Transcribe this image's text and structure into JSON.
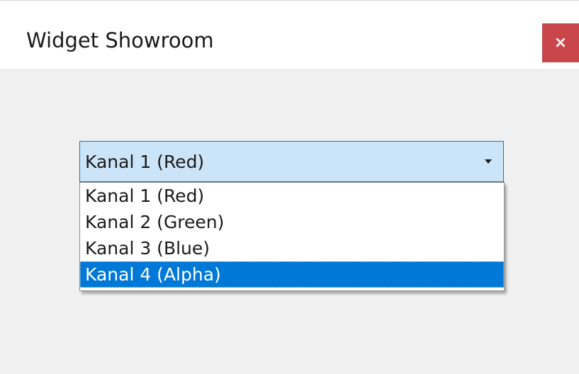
{
  "window": {
    "title": "Widget Showroom",
    "close_label": "×"
  },
  "combo": {
    "selected_value": "Kanal 1 (Red)"
  },
  "dropdown": {
    "options": [
      "Kanal 1 (Red)",
      "Kanal 2 (Green)",
      "Kanal 3 (Blue)",
      "Kanal 4 (Alpha)"
    ],
    "highlighted_option": "Kanal 4 (Alpha)"
  },
  "colors": {
    "titlebar_bg": "#ffffff",
    "window_bg": "#f0f0f0",
    "close_button_bg": "#c9464a",
    "combo_bg": "#cce4f7",
    "combo_border": "#2b6ea8",
    "highlight_bg": "#0078d7"
  },
  "icons": {
    "close": "close-icon",
    "dropdown_arrow": "chevron-down-icon"
  }
}
